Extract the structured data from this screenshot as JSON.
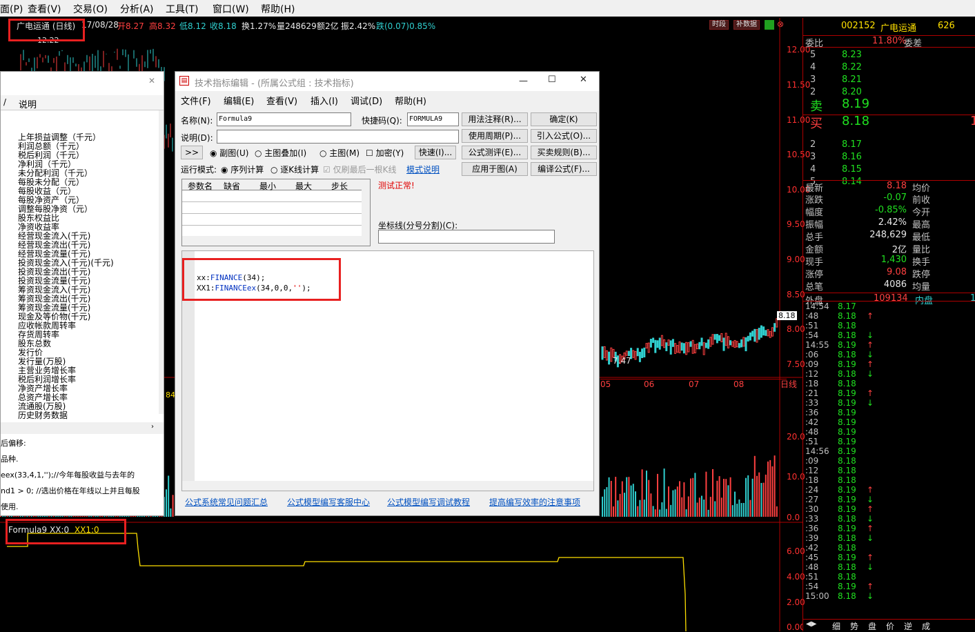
{
  "menubar": [
    "面(P)",
    "查看(V)",
    "交易(O)",
    "分析(A)",
    "工具(T)",
    "窗口(W)",
    "帮助(H)"
  ],
  "info": {
    "name": "广电运通 (日线)",
    "date": "17/08/28",
    "open": "开8.27",
    "high": "高8.32",
    "low": "低8.12",
    "close": "收8.18",
    "turnover": "换1.27%",
    "vol": "量248629",
    "amt": "额2亿",
    "amp": "振2.42%",
    "chg": "跌(0.07)0.85%"
  },
  "buttons": {
    "timeshare": "时段",
    "supplement": "补数据"
  },
  "price_axis": [
    "12.00",
    "11.50",
    "11.00",
    "10.50",
    "10.00",
    "9.50",
    "9.00",
    "8.50",
    "8.00",
    "7.50"
  ],
  "current_price": "8.18",
  "low_mark": "7.47",
  "top_mark": "12.22",
  "months": [
    "05",
    "06",
    "07",
    "08"
  ],
  "period": "日线",
  "vol_label": "84",
  "vol_axis": [
    "20.0",
    "10.0",
    "0.0"
  ],
  "ind_axis": [
    "6.00",
    "4.00",
    "2.00",
    "0.00"
  ],
  "indicator": {
    "name": "Formula9",
    "xx": "XX:0",
    "xx1": "XX1:0"
  },
  "quote": {
    "code": "002152",
    "name": "广电运通",
    "num": "626",
    "wb_label": "委比",
    "wb": "11.80%",
    "wc_label": "委差",
    "sell": [
      {
        "n": "5",
        "p": "8.23"
      },
      {
        "n": "4",
        "p": "8.22"
      },
      {
        "n": "3",
        "p": "8.21"
      },
      {
        "n": "2",
        "p": "8.20"
      },
      {
        "n": "卖",
        "p": "8.19"
      }
    ],
    "buy": [
      {
        "n": "买",
        "p": "8.18",
        "v": "1"
      },
      {
        "n": "2",
        "p": "8.17"
      },
      {
        "n": "3",
        "p": "8.16"
      },
      {
        "n": "4",
        "p": "8.15"
      },
      {
        "n": "5",
        "p": "8.14"
      }
    ],
    "stats": [
      {
        "k": "最新",
        "v": "8.18",
        "k2": "均价"
      },
      {
        "k": "涨跌",
        "v": "-0.07",
        "k2": "前收"
      },
      {
        "k": "幅度",
        "v": "-0.85%",
        "k2": "今开"
      },
      {
        "k": "振幅",
        "v": "2.42%",
        "k2": "最高"
      },
      {
        "k": "总手",
        "v": "248,629",
        "k2": "最低"
      },
      {
        "k": "金额",
        "v": "2亿",
        "k2": "量比"
      },
      {
        "k": "现手",
        "v": "1,430",
        "k2": "换手"
      },
      {
        "k": "涨停",
        "v": "9.08",
        "k2": "跌停"
      },
      {
        "k": "总笔",
        "v": "4086",
        "k2": "均量"
      }
    ],
    "outer": "外盘",
    "outer_v": "109134",
    "inner": "内盘",
    "inner_v": "1",
    "ticks": [
      [
        "14:54",
        "8.17",
        ""
      ],
      [
        ":48",
        "8.18",
        "↑"
      ],
      [
        ":51",
        "8.18",
        ""
      ],
      [
        ":54",
        "8.18",
        "↓"
      ],
      [
        "14:55",
        "8.19",
        "↑"
      ],
      [
        ":06",
        "8.18",
        "↓"
      ],
      [
        ":09",
        "8.19",
        "↑"
      ],
      [
        ":12",
        "8.18",
        "↓"
      ],
      [
        ":18",
        "8.18",
        ""
      ],
      [
        ":21",
        "8.19",
        "↑"
      ],
      [
        ":33",
        "8.19",
        "↓"
      ],
      [
        ":36",
        "8.19",
        ""
      ],
      [
        ":42",
        "8.19",
        ""
      ],
      [
        ":48",
        "8.19",
        ""
      ],
      [
        ":51",
        "8.19",
        ""
      ],
      [
        "14:56",
        "8.19",
        ""
      ],
      [
        ":09",
        "8.18",
        ""
      ],
      [
        ":12",
        "8.18",
        ""
      ],
      [
        ":18",
        "8.18",
        ""
      ],
      [
        ":24",
        "8.19",
        "↑"
      ],
      [
        ":27",
        "8.19",
        "↓"
      ],
      [
        ":30",
        "8.19",
        "↑"
      ],
      [
        ":33",
        "8.18",
        "↓"
      ],
      [
        ":36",
        "8.19",
        "↑"
      ],
      [
        ":39",
        "8.18",
        "↓"
      ],
      [
        ":42",
        "8.18",
        ""
      ],
      [
        ":45",
        "8.19",
        "↑"
      ],
      [
        ":48",
        "8.18",
        "↓"
      ],
      [
        ":51",
        "8.18",
        ""
      ],
      [
        ":54",
        "8.19",
        "↑"
      ],
      [
        "15:00",
        "8.18",
        "↓"
      ]
    ],
    "tabs": [
      "细",
      "势",
      "盘",
      "价",
      "逆",
      "成"
    ]
  },
  "left_panel": {
    "header": "说明",
    "finance": [
      "上年损益调整（千元）",
      "利润总额（千元）",
      "税后利润（千元）",
      "净利润（千元）",
      "未分配利润（千元）",
      "每股未分配（元）",
      "每股收益（元）",
      "每股净资产（元）",
      "调整每股净资（元）",
      "股东权益比",
      "净资收益率",
      "经营现金流入(千元)",
      "经营现金流出(千元)",
      "经营现金流量(千元)",
      "投资现金流入(千元)(千元)",
      "投资现金流出(千元)",
      "投资现金流量(千元)",
      "筹资现金流入(千元)",
      "筹资现金流出(千元)",
      "筹资现金流量(千元)",
      "现金及等价物(千元)",
      "应收帐款周转率",
      "存货周转率",
      "股东总数",
      "发行价",
      "发行量(万股)",
      "主营业务增长率",
      "税后利润增长率",
      "净资产增长率",
      "总资产增长率",
      "流通股(万股)",
      "历史财务数据"
    ],
    "help": [
      "后偏移:",
      "品种.",
      "eex(33,4,1,'');//今年每股收益与去年的",
      "nd1 > 0; //选出价格在年线以上并且每股",
      "使用."
    ]
  },
  "dialog": {
    "title": "技术指标编辑 - (所属公式组 : 技术指标)",
    "menu": [
      "文件(F)",
      "编辑(E)",
      "查看(V)",
      "插入(I)",
      "调试(D)",
      "帮助(H)"
    ],
    "name_label": "名称(N):",
    "name_value": "Formula9",
    "hotkey_label": "快捷码(Q):",
    "hotkey_value": "FORMULA9",
    "desc_label": "说明(D):",
    "right_buttons": [
      "用法注释(R)...",
      "确定(K)",
      "使用周期(P)...",
      "引入公式(O)...",
      "公式测评(E)...",
      "买卖规则(B)...",
      "应用于图(A)",
      "编译公式(F)..."
    ],
    "expand": ">>",
    "radio": [
      "副图(U)",
      "主图叠加(I)",
      "主图(M)"
    ],
    "encrypt": "加密(Y)",
    "quick": "快速(I)...",
    "mode_label": "运行模式:",
    "mode": [
      "序列计算",
      "逐K线计算"
    ],
    "last_only": "仅刷最后一根K线",
    "mode_link": "模式说明",
    "param_cols": [
      "参数名",
      "缺省",
      "最小",
      "最大",
      "步长"
    ],
    "status": "测试正常!",
    "coord_label": "坐标线(分号分割)(C):",
    "code": [
      "xx:FINANCE(34);",
      "XX1:FINANCEex(34,0,0,'');"
    ],
    "links": [
      "公式系统常见问题汇总",
      "公式模型编写客服中心",
      "公式模型编写调试教程",
      "提高编写效率的注意事项"
    ]
  },
  "colors": {
    "up": "#ff4040",
    "down": "#30d0d0",
    "line": "#ffe000",
    "axis": "#b00000"
  }
}
